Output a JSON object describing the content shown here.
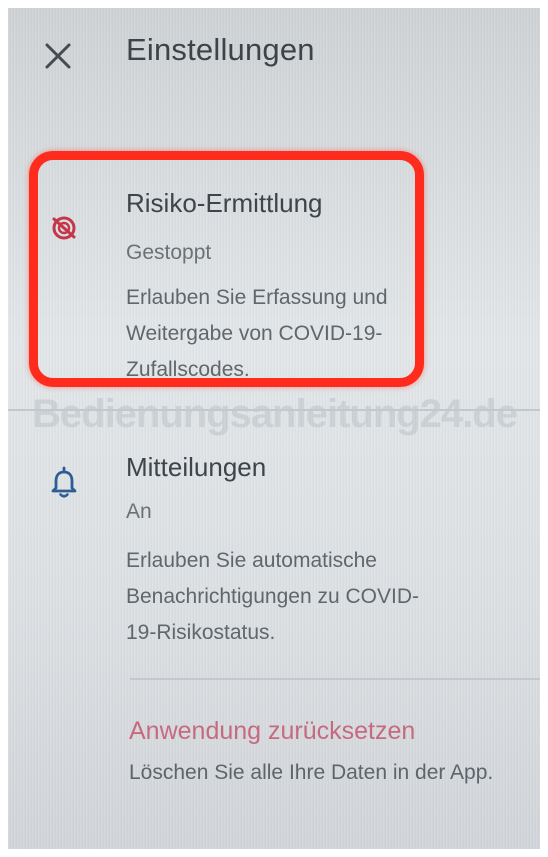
{
  "header": {
    "title": "Einstellungen",
    "close_icon": "close-icon"
  },
  "settings": {
    "risk": {
      "icon": "exposure-notification-off-icon",
      "title": "Risiko-Ermittlung",
      "status": "Gestoppt",
      "description": "Erlauben Sie Erfassung und Weitergabe von COVID-19-Zufallscodes."
    },
    "notifications": {
      "icon": "bell-icon",
      "title": "Mitteilungen",
      "status": "An",
      "description": "Erlauben Sie automatische Benachrichtigungen zu COVID-19-Risikostatus."
    },
    "reset": {
      "title": "Anwendung zurücksetzen",
      "description": "Löschen Sie alle Ihre Daten in der App."
    }
  },
  "watermark": "Bedienungsanleitung24.de",
  "colors": {
    "highlight": "#ff2b1c",
    "reset_accent": "#c66a80",
    "bell_icon": "#2e5d93",
    "stopped_icon": "#c4364a"
  }
}
